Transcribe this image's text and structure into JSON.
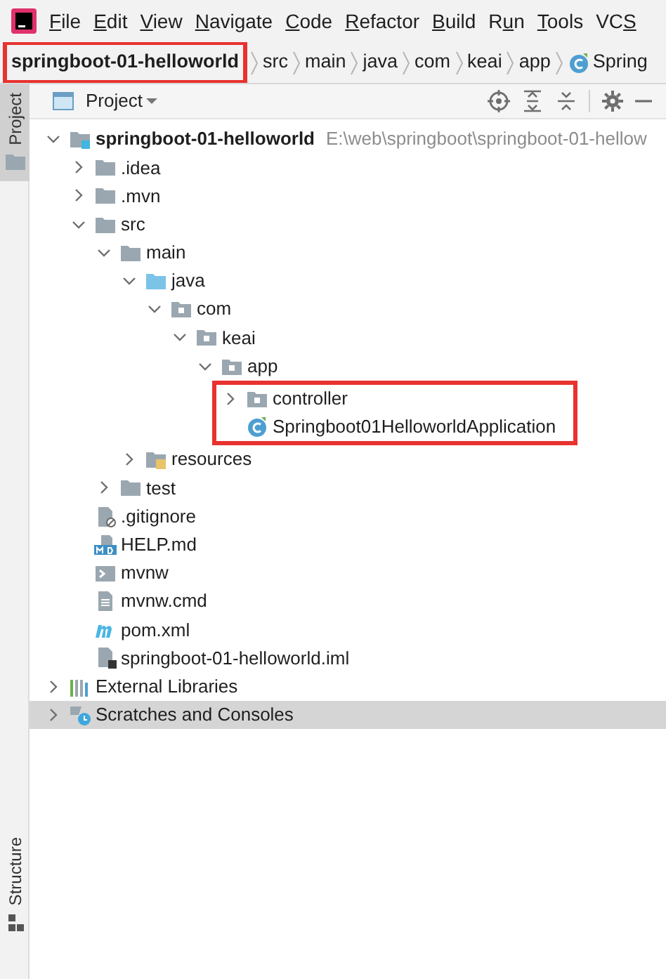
{
  "menu": [
    {
      "key": "F",
      "post": "ile"
    },
    {
      "key": "E",
      "post": "dit"
    },
    {
      "key": "V",
      "post": "iew"
    },
    {
      "key": "N",
      "post": "avigate"
    },
    {
      "key": "C",
      "post": "ode"
    },
    {
      "key": "R",
      "post": "efactor"
    },
    {
      "key": "B",
      "post": "uild"
    },
    {
      "pre": "R",
      "key": "u",
      "post": "n"
    },
    {
      "key": "T",
      "post": "ools"
    },
    {
      "pre": "VC",
      "key": "S"
    }
  ],
  "breadcrumb": [
    {
      "label": "springboot-01-helloworld",
      "kind": "module",
      "highlighted": true
    },
    {
      "label": "src",
      "kind": "dir",
      "highlighted": false
    },
    {
      "label": "main",
      "kind": "dir",
      "highlighted": false
    },
    {
      "label": "java",
      "kind": "dir",
      "highlighted": false
    },
    {
      "label": "com",
      "kind": "dir",
      "highlighted": false
    },
    {
      "label": "keai",
      "kind": "dir",
      "highlighted": false
    },
    {
      "label": "app",
      "kind": "dir",
      "highlighted": false
    },
    {
      "label": "Spring",
      "kind": "class",
      "highlighted": false
    }
  ],
  "tool_windows": [
    {
      "label": "Project",
      "kind": "project",
      "selected": true
    },
    {
      "label": "Structure",
      "kind": "structure",
      "selected": false
    }
  ],
  "panel": {
    "title": "Project"
  },
  "tree": [
    {
      "name": "springboot-01-helloworld",
      "path": "E:\\web\\springboot\\springboot-01-hellow",
      "kind": "module",
      "expanded": true,
      "selected": false,
      "children": [
        {
          "name": ".idea",
          "kind": "folder",
          "expanded": false,
          "selected": false
        },
        {
          "name": ".mvn",
          "kind": "folder",
          "expanded": false,
          "selected": false
        },
        {
          "name": "src",
          "kind": "folder",
          "expanded": true,
          "selected": false,
          "children": [
            {
              "name": "main",
              "kind": "folder",
              "expanded": true,
              "selected": false,
              "children": [
                {
                  "name": "java",
                  "kind": "source",
                  "expanded": true,
                  "selected": false,
                  "children": [
                    {
                      "name": "com",
                      "kind": "package",
                      "expanded": true,
                      "selected": false,
                      "children": [
                        {
                          "name": "keai",
                          "kind": "package",
                          "expanded": true,
                          "selected": false,
                          "children": [
                            {
                              "name": "app",
                              "kind": "package",
                              "expanded": true,
                              "selected": false,
                              "children": [
                                {
                                  "name": "controller",
                                  "kind": "package",
                                  "expanded": false,
                                  "selected": false,
                                  "highlighted": true
                                },
                                {
                                  "name": "Springboot01HelloworldApplication",
                                  "kind": "class",
                                  "selected": false,
                                  "highlighted": true
                                }
                              ]
                            }
                          ]
                        }
                      ]
                    }
                  ]
                },
                {
                  "name": "resources",
                  "kind": "resources",
                  "expanded": false,
                  "selected": false
                }
              ]
            },
            {
              "name": "test",
              "kind": "folder",
              "expanded": false,
              "selected": false
            }
          ]
        },
        {
          "name": ".gitignore",
          "kind": "gitignore",
          "selected": false
        },
        {
          "name": "HELP.md",
          "kind": "markdown",
          "selected": false
        },
        {
          "name": "mvnw",
          "kind": "script",
          "selected": false
        },
        {
          "name": "mvnw.cmd",
          "kind": "text",
          "selected": false
        },
        {
          "name": "pom.xml",
          "kind": "maven",
          "selected": false
        },
        {
          "name": "springboot-01-helloworld.iml",
          "kind": "iml",
          "selected": false
        }
      ]
    },
    {
      "name": "External Libraries",
      "kind": "libraries",
      "expanded": false,
      "selected": false
    },
    {
      "name": "Scratches and Consoles",
      "kind": "scratches",
      "expanded": false,
      "selected": true
    }
  ]
}
